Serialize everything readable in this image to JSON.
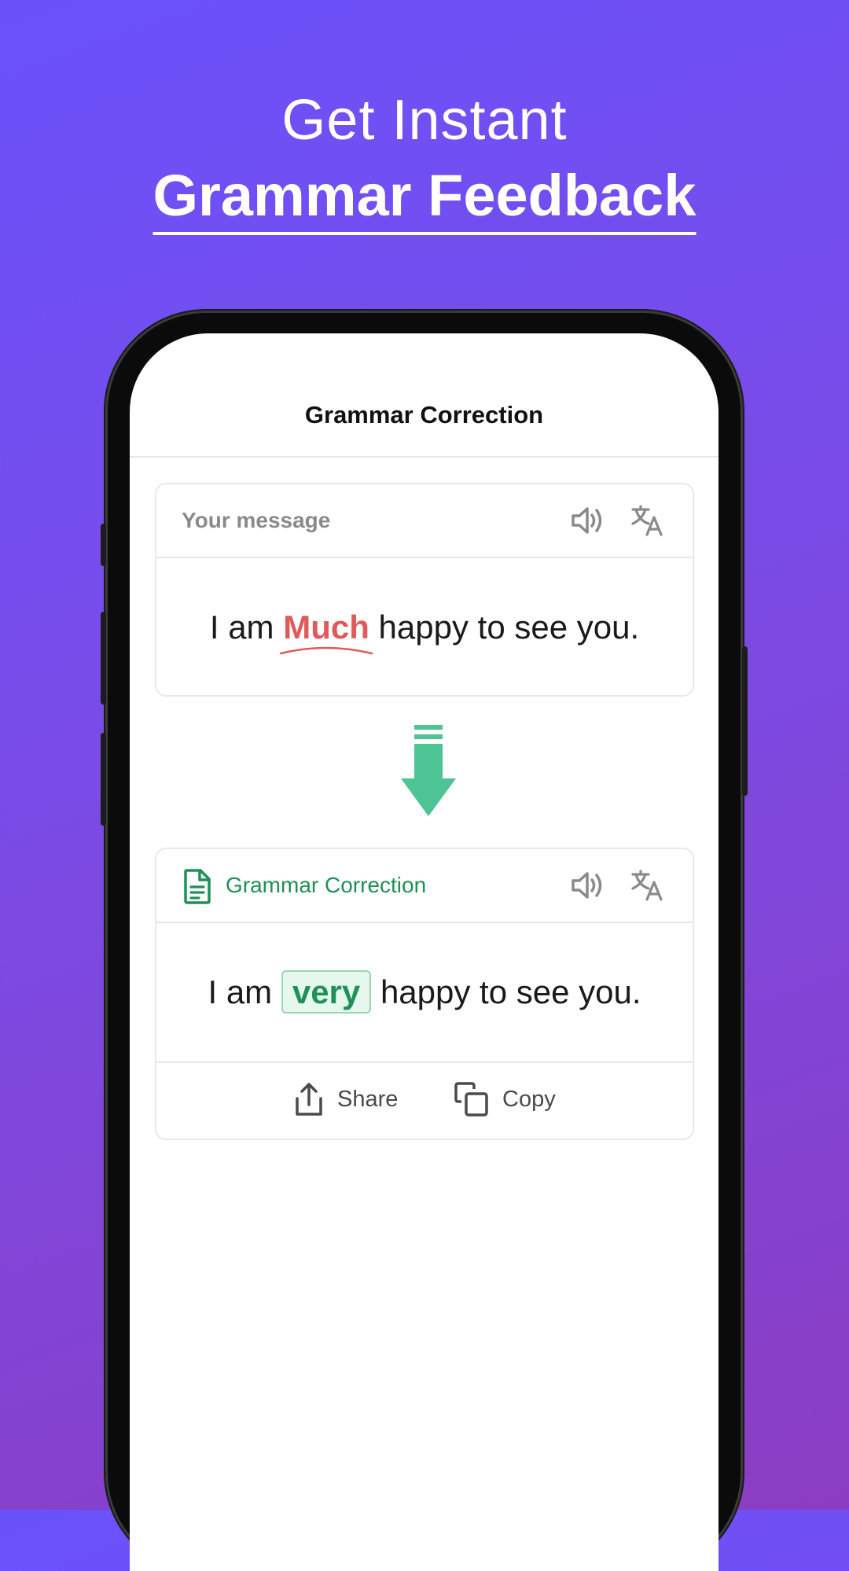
{
  "headline": {
    "line1": "Get Instant",
    "line2": "Grammar Feedback"
  },
  "screen": {
    "title": "Grammar Correction"
  },
  "input_card": {
    "label": "Your message",
    "sentence_before": "I am",
    "error_word": "Much",
    "sentence_after": "happy to see you.",
    "icons": [
      "speaker-icon",
      "translate-icon"
    ]
  },
  "output_card": {
    "label": "Grammar Correction",
    "sentence_before": "I am",
    "corrected_word": "very",
    "sentence_after": "happy to see you.",
    "icons": [
      "document-icon",
      "speaker-icon",
      "translate-icon"
    ],
    "actions": {
      "share_label": "Share",
      "copy_label": "Copy"
    }
  },
  "colors": {
    "background_start": "#6a52fb",
    "background_end": "#8b3dc2",
    "error": "#e05a5a",
    "correct": "#1f9156",
    "arrow": "#4cc493"
  }
}
